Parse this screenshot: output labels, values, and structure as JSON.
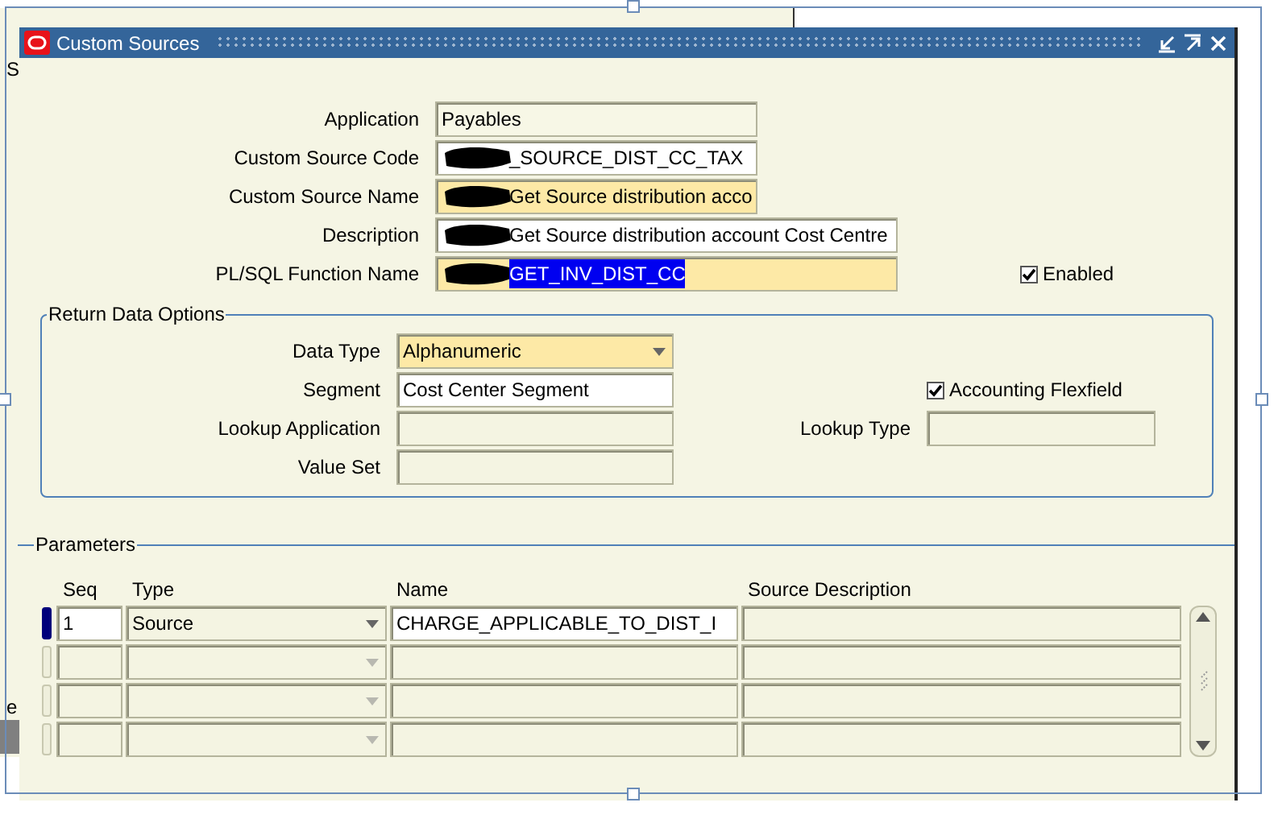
{
  "background_window": {
    "texts": [
      "S",
      "e"
    ]
  },
  "window": {
    "title": "Custom Sources"
  },
  "form": {
    "fields": [
      {
        "label": "Application",
        "value": "Payables",
        "kind": "readonly",
        "redacted": false,
        "highlighted": false
      },
      {
        "label": "Custom Source Code",
        "value": "_SOURCE_DIST_CC_TAX",
        "kind": "text",
        "redacted": true,
        "highlighted": false
      },
      {
        "label": "Custom Source Name",
        "value": "Get Source distribution acco",
        "kind": "required",
        "redacted": true,
        "highlighted": false
      },
      {
        "label": "Description",
        "value": "Get Source distribution account Cost Centre",
        "kind": "text",
        "redacted": true,
        "highlighted": false
      },
      {
        "label": "PL/SQL Function Name",
        "value": "GET_INV_DIST_CC",
        "kind": "required",
        "redacted": true,
        "highlighted": true
      }
    ],
    "enabled": {
      "label": "Enabled",
      "checked": true
    }
  },
  "return_data_options": {
    "title": "Return Data Options",
    "data_type": {
      "label": "Data Type",
      "value": "Alphanumeric"
    },
    "segment": {
      "label": "Segment",
      "value": "Cost Center Segment"
    },
    "lookup_application": {
      "label": "Lookup Application"
    },
    "value_set": {
      "label": "Value Set"
    },
    "accounting_flexfield": {
      "label": "Accounting Flexfield",
      "checked": true
    },
    "lookup_type": {
      "label": "Lookup Type"
    }
  },
  "parameters": {
    "title": "Parameters",
    "columns": [
      "Seq",
      "Type",
      "Name",
      "Source Description"
    ],
    "rows": [
      {
        "seq": "1",
        "type": "Source",
        "name": "CHARGE_APPLICABLE_TO_DIST_I",
        "selected": true
      },
      {
        "selected": false
      },
      {
        "selected": false
      },
      {
        "selected": false
      }
    ]
  }
}
